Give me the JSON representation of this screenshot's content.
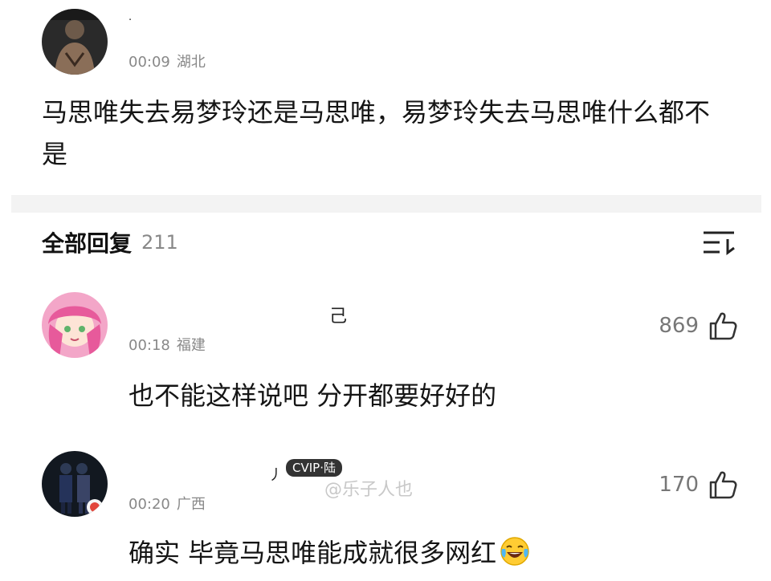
{
  "post": {
    "username": "·",
    "time": "00:09",
    "location": "湖北",
    "text": "马思唯失去易梦玲还是马思唯，易梦玲失去马思唯什么都不是"
  },
  "replies_header": {
    "title": "全部回复",
    "count": "211",
    "sort_icon": "sort-list-icon"
  },
  "replies": [
    {
      "name_mark": "己",
      "time": "00:18",
      "location": "福建",
      "likes": "869",
      "text": "也不能这样说吧 分开都要好好的"
    },
    {
      "name_mark": "丿",
      "badge": "CVIP·陆",
      "watermark": "@乐子人也",
      "time": "00:20",
      "location": "广西",
      "likes": "170",
      "text": "确实 毕竟马思唯能成就很多网红",
      "emoji": "laughing-tears-emoji"
    }
  ],
  "colors": {
    "meta_gray": "#888888",
    "text": "#151515",
    "divider": "#f3f3f3"
  }
}
